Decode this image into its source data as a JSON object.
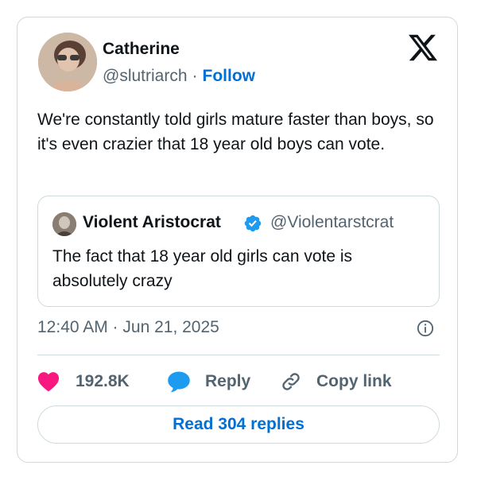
{
  "author": {
    "name": "Catherine",
    "handle": "@slutriarch",
    "separator": "·",
    "follow_label": "Follow"
  },
  "tweet": {
    "text": "We're constantly told girls mature faster than boys, so it's even crazier that 18 year old boys can vote.",
    "timestamp": "12:40 AM · Jun 21, 2025"
  },
  "quoted": {
    "name": "Violent Aristocrat",
    "handle": "@Violentarstcrat",
    "text": "The fact that 18 year old girls can vote is absolutely crazy",
    "verified": true
  },
  "actions": {
    "like_count": "192.8K",
    "reply_label": "Reply",
    "copy_link_label": "Copy link"
  },
  "read_replies_label": "Read 304 replies",
  "icons": {
    "logo": "x-logo-icon",
    "verified": "verified-badge-icon",
    "info": "info-icon",
    "like": "heart-icon",
    "reply": "reply-bubble-icon",
    "copy": "link-icon"
  },
  "colors": {
    "accent": "#006fd6",
    "heart": "#f91880",
    "reply_bubble": "#1d9bf0",
    "muted_text": "#536471",
    "border": "#cfd9de"
  }
}
